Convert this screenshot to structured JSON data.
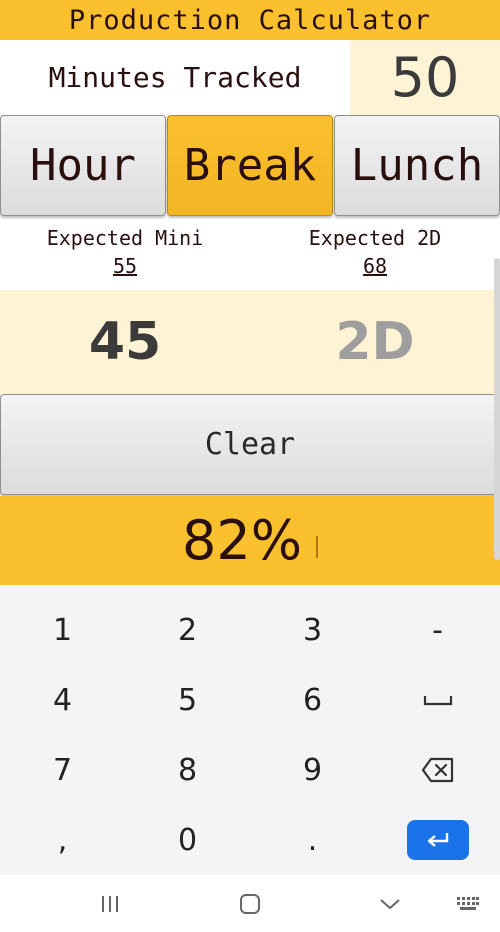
{
  "app": {
    "title": "Production Calculator"
  },
  "tracking": {
    "label": "Minutes Tracked",
    "value": "50"
  },
  "modes": [
    {
      "label": "Hour",
      "active": false
    },
    {
      "label": "Break",
      "active": true
    },
    {
      "label": "Lunch",
      "active": false
    }
  ],
  "expected": {
    "mini": {
      "label": "Expected Mini",
      "value": "55"
    },
    "twod": {
      "label": "Expected 2D",
      "value": "68"
    }
  },
  "counts": {
    "mini": {
      "value": "45",
      "color": "#3b3b3b"
    },
    "twod": {
      "placeholder": "2D",
      "color": "#9e9e9e"
    }
  },
  "actions": {
    "clear_label": "Clear"
  },
  "result": {
    "percent": "82%"
  },
  "keyboard": {
    "rows": [
      [
        "1",
        "2",
        "3",
        "-"
      ],
      [
        "4",
        "5",
        "6",
        "space-icon"
      ],
      [
        "7",
        "8",
        "9",
        "backspace-icon"
      ],
      [
        ",",
        "0",
        ".",
        "enter-icon"
      ]
    ],
    "enter_color": "#1a73e8"
  },
  "nav": {
    "icons": [
      "recent-apps-icon",
      "home-icon",
      "back-icon",
      "keyboard-icon"
    ]
  },
  "colors": {
    "accent": "#fbc02d",
    "cream": "#fff3d6",
    "text_dark": "#2a0f0f"
  }
}
